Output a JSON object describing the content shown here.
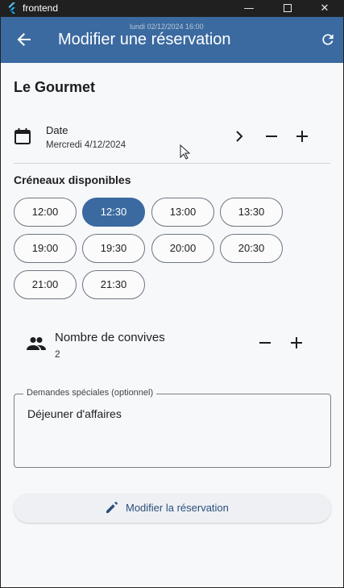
{
  "window": {
    "app_title": "frontend",
    "timestamp_overlay": "lundi 02/12/2024 16:00",
    "minimize_glyph": "—",
    "close_glyph": "✕"
  },
  "appbar": {
    "title": "Modifier une réservation",
    "back_icon": "arrow-back-icon",
    "refresh_icon": "refresh-icon",
    "color": "#3b6aa0"
  },
  "restaurant": {
    "name": "Le Gourmet"
  },
  "date": {
    "label": "Date",
    "value": "Mercredi 4/12/2024",
    "minus": "−",
    "plus": "+"
  },
  "slots": {
    "title": "Créneaux disponibles",
    "items": [
      "12:00",
      "12:30",
      "13:00",
      "13:30",
      "19:00",
      "19:30",
      "20:00",
      "20:30",
      "21:00",
      "21:30"
    ],
    "selected": "12:30"
  },
  "guests": {
    "label": "Nombre de convives",
    "value": "2"
  },
  "special_requests": {
    "label": "Demandes spéciales (optionnel)",
    "value": "Déjeuner d'affaires"
  },
  "submit": {
    "label": "Modifier la réservation"
  },
  "colors": {
    "primary": "#3b6aa0",
    "background": "#f7f8fa",
    "titlebar": "#202020"
  }
}
